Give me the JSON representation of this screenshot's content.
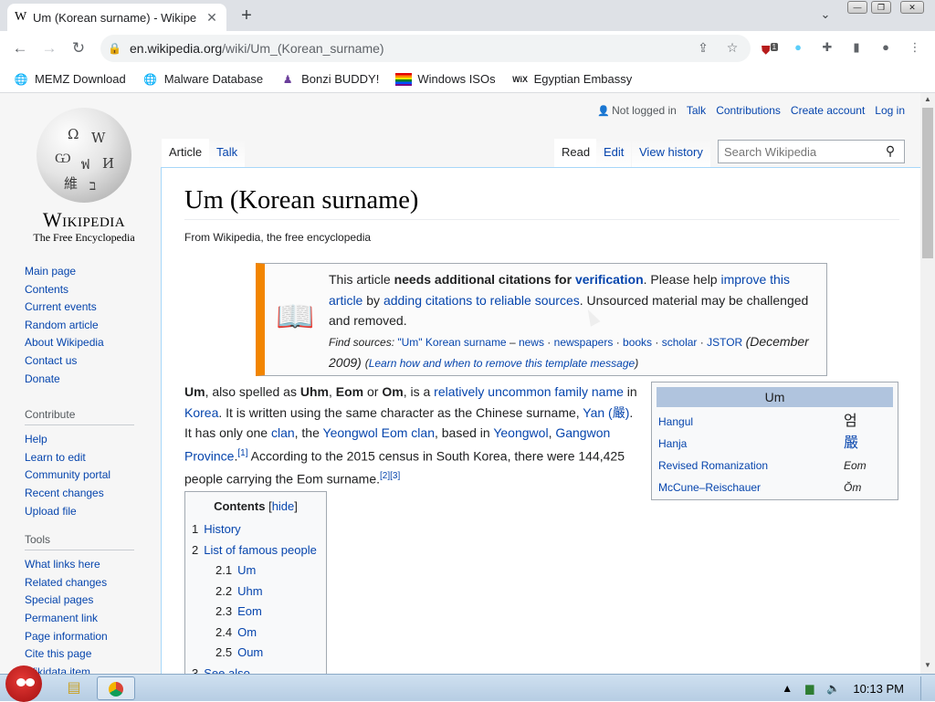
{
  "browser": {
    "tab_favicon": "W",
    "tab_title": "Um (Korean surname) - Wikipe",
    "tab_close": "✕",
    "new_tab": "+",
    "url_host": "en.wikipedia.org",
    "url_path": "/wiki/Um_(Korean_surname)",
    "extension_badge": "1",
    "bookmarks": [
      {
        "label": "MEMZ Download",
        "icon": "globe-icon"
      },
      {
        "label": "Malware Database",
        "icon": "globe-icon"
      },
      {
        "label": "Bonzi BUDDY!",
        "icon": "bonzi-icon"
      },
      {
        "label": "Windows ISOs",
        "icon": "rainbow-flag-icon"
      },
      {
        "label": "Egyptian Embassy",
        "icon": "wix-icon"
      }
    ]
  },
  "wiki": {
    "wordmark": "Wikipedia",
    "tagline": "The Free Encyclopedia",
    "personal": {
      "not_logged_in": "Not logged in",
      "talk": "Talk",
      "contributions": "Contributions",
      "create_account": "Create account",
      "log_in": "Log in"
    },
    "tabs": {
      "article": "Article",
      "talk": "Talk",
      "read": "Read",
      "edit": "Edit",
      "view_history": "View history"
    },
    "search_placeholder": "Search Wikipedia",
    "nav_main": [
      "Main page",
      "Contents",
      "Current events",
      "Random article",
      "About Wikipedia",
      "Contact us",
      "Donate"
    ],
    "contribute_head": "Contribute",
    "nav_contribute": [
      "Help",
      "Learn to edit",
      "Community portal",
      "Recent changes",
      "Upload file"
    ],
    "tools_head": "Tools",
    "nav_tools": [
      "What links here",
      "Related changes",
      "Special pages",
      "Permanent link",
      "Page information",
      "Cite this page",
      "Wikidata item"
    ]
  },
  "article": {
    "title": "Um (Korean surname)",
    "from": "From Wikipedia, the free encyclopedia",
    "ambox": {
      "p1": "This article ",
      "p2": "needs additional citations for ",
      "p3": "verification",
      "p4": ". Please help ",
      "p5": "improve this article",
      "p6": " by ",
      "p7": "adding citations to reliable sources",
      "p8": ". Unsourced material may be challenged and removed.",
      "find_sources": "Find sources:",
      "fs_query": "\"Um\" Korean surname",
      "fs_dash": " – ",
      "news": "news",
      "newspapers": "newspapers",
      "books": "books",
      "scholar": "scholar",
      "jstor": "JSTOR",
      "date": "(December 2009)",
      "learn": "Learn how and when to remove this template message",
      "dot": " · "
    },
    "lead": {
      "um": "Um",
      "t1": ", also spelled as ",
      "uhm": "Uhm",
      "t2": ", ",
      "eom": "Eom",
      "t3": " or ",
      "om": "Om",
      "t4": ", is a ",
      "l1": "relatively uncommon family name",
      "t5": " in ",
      "l2": "Korea",
      "t6": ". It is written using the same character as the Chinese surname, ",
      "l3": "Yan (嚴)",
      "t7": ". It has only one ",
      "l4": "clan",
      "t8": ", the ",
      "l5": "Yeongwol Eom clan",
      "t9": ", based in ",
      "l6": "Yeongwol",
      "t10": ", ",
      "l7": "Gangwon Province",
      "t11": ".",
      "ref1": "[1]",
      "t12": " According to the 2015 census in South Korea, there were 144,425 people carrying the Eom surname.",
      "ref2": "[2]",
      "ref3": "[3]"
    },
    "infobox": {
      "head": "Um",
      "rows": [
        {
          "label": "Hangul",
          "value": "엄"
        },
        {
          "label": "Hanja",
          "value": "嚴"
        },
        {
          "label": "Revised Romanization",
          "value": "Eom"
        },
        {
          "label": "McCune–Reischauer",
          "value": "Ŏm"
        }
      ]
    },
    "toc": {
      "title": "Contents",
      "hide": "hide",
      "items": [
        {
          "num": "1",
          "text": "History",
          "sub": false
        },
        {
          "num": "2",
          "text": "List of famous people",
          "sub": false
        },
        {
          "num": "2.1",
          "text": "Um",
          "sub": true
        },
        {
          "num": "2.2",
          "text": "Uhm",
          "sub": true
        },
        {
          "num": "2.3",
          "text": "Eom",
          "sub": true
        },
        {
          "num": "2.4",
          "text": "Om",
          "sub": true
        },
        {
          "num": "2.5",
          "text": "Oum",
          "sub": true
        },
        {
          "num": "3",
          "text": "See also",
          "sub": false
        }
      ]
    }
  },
  "taskbar": {
    "clock": "10:13 PM"
  }
}
